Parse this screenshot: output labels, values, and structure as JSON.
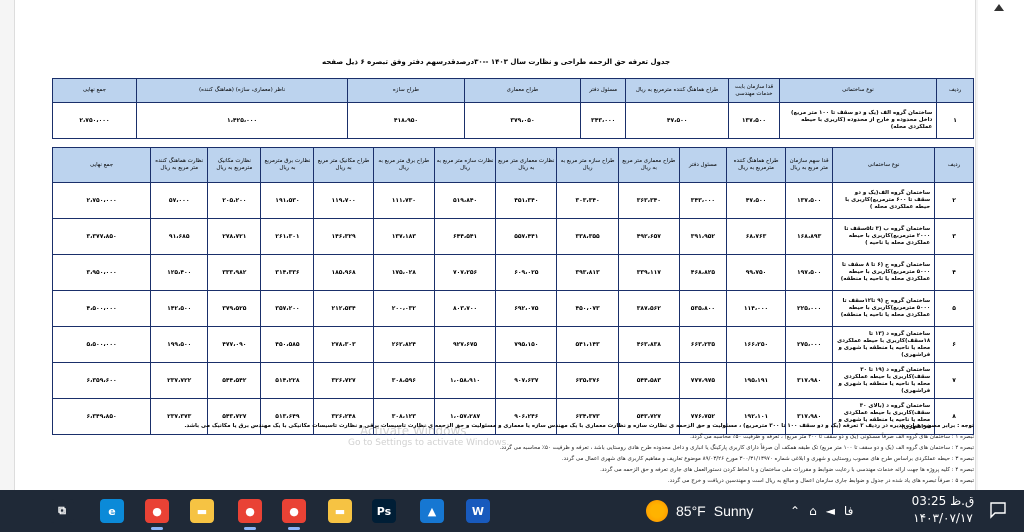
{
  "document": {
    "title": "جدول تعرفه حق الزحمه طراحی و نظارت سال ۱۴۰۳ --۳۰درصدقدرسهم دفتر وفق تبصره ۶ ذیل صفحه"
  },
  "table1": {
    "headers": [
      "ردیف",
      "نوع ساختمانی",
      "قدا سازمان بابت خدمات مهندسی",
      "طراح هماهنگ کننده مترمربع به ریال",
      "مسئول دفتر",
      "طراح معماری",
      "طراح سازه",
      "ناظر (معماری، سازه) (هماهنگ کننده)",
      "جمع نهایی"
    ],
    "row": {
      "num": "۱",
      "desc": "ساختمان گروه الف (یک و دو سقف تا ۱۰۰ متر مربع) داخل محدوده و خارج از محدوده (کاربری با حیطه عملکردی محله)",
      "values": [
        "۱۳۷،۵۰۰",
        "۴۷،۵۰۰",
        "۳۴۳،۰۰۰",
        "۳۷۹،۰۵۰",
        "۴۱۸،۹۵۰",
        "۱،۴۲۵،۰۰۰",
        "۲،۷۵۰،۰۰۰"
      ]
    }
  },
  "table2": {
    "headers": [
      "ردیف",
      "نوع ساختمانی",
      "قدا سهم سازمان متر مربع به ریال",
      "طراح هماهنگ کننده مترمربع به ریال",
      "مسئول دفتر",
      "طراح معماری متر مربع به ریال",
      "طراح سازه متر مربع به ریال",
      "نظارت معماری متر مربع به ریال",
      "نظارت سازه متر مربع به ریال",
      "طراح برق متر مربع به ریال",
      "طراح مکانیک متر مربع به ریال",
      "نظارت برق مترمربع به ریال",
      "نظارت مکانیک مترمربع به ریال",
      "نظارت هماهنگ کننده متر مربع به ریال",
      "جمع نهایی"
    ],
    "rows": [
      {
        "num": "۲",
        "desc": "ساختمان گروه الف(یک و دو سقف تا ۶۰۰ مترمربع)کاربری با حیطه عملکردی محله )",
        "values": [
          "۱۳۷،۵۰۰",
          "۴۷،۵۰۰",
          "۳۴۳،۰۰۰",
          "۳۶۳،۳۴۰",
          "۳۰۳،۳۴۰",
          "۴۵۱،۳۴۰",
          "۵۱۹،۸۴۰",
          "۱۱۱،۷۳۰",
          "۱۱۹،۷۰۰",
          "۱۹۱،۵۳۰",
          "۲۰۵،۲۰۰",
          "۵۷،۰۰۰",
          "۲،۷۵۰،۰۰۰"
        ]
      },
      {
        "num": "۳",
        "desc": "ساختمان گروه ب (۳ تا۵سقف تا ۲۰۰۰ مترمربع)کاربری با حیطه عملکردی محله یا ناحیه )",
        "values": [
          "۱۶۸،۸۹۳",
          "۶۸،۷۶۳",
          "۳۹۱،۹۵۲",
          "۴۹۲،۶۵۷",
          "۳۳۸،۳۵۵",
          "۵۵۷،۴۴۱",
          "۶۴۴،۵۴۱",
          "۱۳۷،۱۸۳",
          "۱۴۶،۳۲۹",
          "۲۶۱،۳۰۱",
          "۲۷۸،۷۲۱",
          "۹۱،۶۸۵",
          "۳،۳۷۷،۸۵۰"
        ]
      },
      {
        "num": "۴",
        "desc": "ساختمان گروه ج (۶ تا ۸ سقف تا ۵۰۰۰ مترمربع)کاربری با حیطه عملکردی محله یا ناحیه یا منطقه)",
        "values": [
          "۱۹۷،۵۰۰",
          "۹۹،۷۵۰",
          "۴۶۸،۸۲۵",
          "۳۳۹،۱۱۷",
          "۳۹۳،۸۱۳",
          "۶۰۹،۰۲۵",
          "۷۰۷،۲۵۶",
          "۱۷۵،۰۲۸",
          "۱۸۵،۹۶۸",
          "۳۱۴،۳۳۶",
          "۳۳۳،۹۸۲",
          "۱۲۵،۴۰۰",
          "۳،۹۵۰،۰۰۰"
        ]
      },
      {
        "num": "۵",
        "desc": "ساختمان گروه ج (۹ تا۱۲سقف تا ۵۰۰۰ مترمربع)کاربری با حیطه عملکردی محله یا ناحیه یا منطقه)",
        "values": [
          "۲۲۵،۰۰۰",
          "۱۱۴،۰۰۰",
          "۵۳۵،۸۰۰",
          "۳۸۷،۵۶۲",
          "۴۵۰،۰۷۳",
          "۶۹۲،۰۷۵",
          "۸۰۳،۷۰۰",
          "۲۰۰،۰۳۲",
          "۲۱۲،۵۳۴",
          "۳۵۷،۲۰۰",
          "۳۷۹،۵۲۵",
          "۱۴۲،۵۰۰",
          "۴،۵۰۰،۰۰۰"
        ]
      },
      {
        "num": "۶",
        "desc": "ساختمان گروه د (۱۳ تا ۱۸سقف)کاربری با حیطه عملکردی محله یا ناحیه یا منطقه یا شهری و فراشهری)",
        "values": [
          "۲۷۵،۰۰۰",
          "۱۶۶،۲۵۰",
          "۶۶۳،۲۳۵",
          "۴۶۳،۸۳۸",
          "۵۴۱،۱۴۳",
          "۷۹۵،۱۵۰",
          "۹۲۷،۶۷۵",
          "۲۶۲،۸۲۴",
          "۲۷۸،۳۰۳",
          "۴۵۰،۵۸۵",
          "۴۷۷،۰۹۰",
          "۱۹۹،۵۰۰",
          "۵،۵۰۰،۰۰۰"
        ]
      },
      {
        "num": "۷",
        "desc": "ساختمان گروه د (۱۹ تا ۳۰ سقف)کاربری با حیطه عملکردی محله یا ناحیه یا منطقه یا شهری و فراشهری)",
        "values": [
          "۳۱۷،۹۸۰",
          "۱۹۵،۱۹۱",
          "۷۷۷،۹۷۵",
          "۵۴۴،۵۸۳",
          "۶۳۵،۳۷۶",
          "۹۰۷،۶۳۷",
          "۱،۰۵۸،۹۱۰",
          "۳۰۸،۵۹۶",
          "۳۲۶،۷۲۷",
          "۵۱۴،۲۲۸",
          "۵۴۴،۵۴۲",
          "۲۳۷،۷۲۲",
          "۶،۳۵۹،۶۰۰"
        ]
      },
      {
        "num": "۸",
        "desc": "ساختمان گروه د (بالای ۳۰ سقف)کاربری با حیطه عملکردی محله یا ناحیه یا منطقه یا شهری و فراشهری)",
        "values": [
          "۳۱۷،۹۸۰",
          "۱۹۲،۱۰۱",
          "۷۷۶،۷۵۲",
          "۵۴۳،۷۲۷",
          "۶۳۴،۳۷۳",
          "۹۰۶،۲۴۶",
          "۱،۰۵۷،۲۸۷",
          "۳۰۸،۱۲۳",
          "۳۲۶،۲۴۸",
          "۵۱۳،۶۴۹",
          "۵۴۳،۷۲۷",
          "۲۳۷،۳۷۳",
          "۶،۳۴۹،۸۵۰"
        ]
      }
    ]
  },
  "notes": {
    "main": "توجه : برابر مصوبه هیات مدیره در ردیف ۲ تعرفه (یک و دو سقف ۱۰۰ تا ۳۰۰ مترمربع) ، مسئولیت و حق الزحمه ی نظارت سازه و نظارت معماری با یک مهندس سازه یا معماری و مسئولیت و حق الزحمه ی نظارت تاسیسات برقی و نظارت تاسیسات مکانیکی با یک مهندس برق یا مکانیک می باشد.",
    "n1": "تبصره ۱ : ساختمان های گروه الف صرفاً مسکونی (یک و دو سقف تا ۲۰۰ متر مربع) ، تعرفه و ظرفیت ۵۰٪ محاسبه می گردد.",
    "n2": "تبصره ۲ : ساختمان های گروه الف (یک و دو سقف تا ۱۰۰ متر مربع) تک طبقه همکف آن صرفاً دارای کاربری پارکینگ یا انباری و داخل محدوده طرح هادی روستایی باشد ، تعرفه و ظرفیت ۵۰٪ محاسبه می گردد.",
    "n3": "تبصره ۳ : حیطه عملکردی براساس طرح های مصوب روستایی و شهری و ابلاغی شماره ۳۰۰/۳۱/۱۳۹۷۰ مورخ ۸۹/۰۳/۲۶ موضوع تعاریف و مفاهیم کاربری های شهری اعمال می گردد.",
    "n4": "تبصره ۴ : کلیه پروژه ها جهت ارائه خدمات مهندسی با رعایت ضوابط و مقررات ملی ساختمان و با لحاظ کردن دستورالعمل های جاری تعرفه و حق الزحمه می گردد.",
    "n5": "تبصره ۵ : صرفاً تبصره های یاد شده در جدول و ضوابط جاری سازمان اعمال و مبالغ به ریال است و مهندسین دریافت و خرج می گردد.",
    "watermark": "Activate Windows",
    "watermark_sub": "Go to Settings to activate Windows."
  },
  "taskbar": {
    "apps": [
      {
        "name": "task-view",
        "glyph": "⧉",
        "color": "#1f2937"
      },
      {
        "name": "edge",
        "glyph": "e",
        "color": "#0b8ad8"
      },
      {
        "name": "chrome",
        "glyph": "●",
        "color": "#e94235"
      },
      {
        "name": "file-explorer",
        "glyph": "▬",
        "color": "#f6c343"
      },
      {
        "name": "chrome-2",
        "glyph": "●",
        "color": "#e94235"
      },
      {
        "name": "chrome-3",
        "glyph": "●",
        "color": "#e94235"
      },
      {
        "name": "folder",
        "glyph": "▬",
        "color": "#f6c343"
      },
      {
        "name": "photoshop",
        "glyph": "Ps",
        "color": "#001e36"
      },
      {
        "name": "photos",
        "glyph": "▲",
        "color": "#1677d2"
      },
      {
        "name": "word",
        "glyph": "W",
        "color": "#185abd"
      }
    ],
    "weather": {
      "temp": "85°F",
      "condition": "Sunny"
    },
    "lang": "فا",
    "time": "ق.ظ 03:25",
    "date": "۱۴۰۳/۰۷/۱۷"
  }
}
